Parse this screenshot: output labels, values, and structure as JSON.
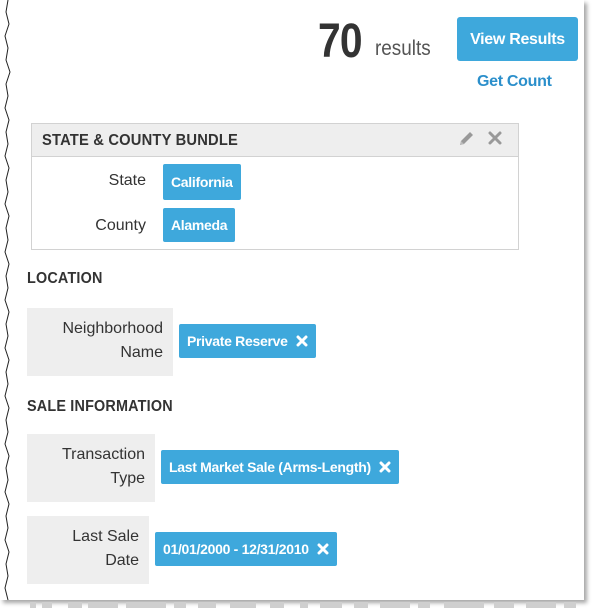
{
  "header": {
    "count": "70",
    "count_suffix": "results",
    "view_results_label": "View Results",
    "get_count_label": "Get Count"
  },
  "bundle": {
    "title": "STATE & COUNTY BUNDLE",
    "rows": [
      {
        "label": "State",
        "value": "California"
      },
      {
        "label": "County",
        "value": "Alameda"
      }
    ]
  },
  "location": {
    "heading": "LOCATION",
    "neighborhood_label_line1": "Neighborhood",
    "neighborhood_label_line2": "Name",
    "neighborhood_value": "Private Reserve"
  },
  "sale": {
    "heading": "SALE INFORMATION",
    "transaction_label_line1": "Transaction",
    "transaction_label_line2": "Type",
    "transaction_value": "Last Market Sale (Arms-Length)",
    "last_sale_label_line1": "Last Sale",
    "last_sale_label_line2": "Date",
    "last_sale_value": "01/01/2000 - 12/31/2010"
  },
  "colors": {
    "accent": "#3ea8dc",
    "link": "#2b8fcb",
    "label_bg": "#eeeeee"
  }
}
